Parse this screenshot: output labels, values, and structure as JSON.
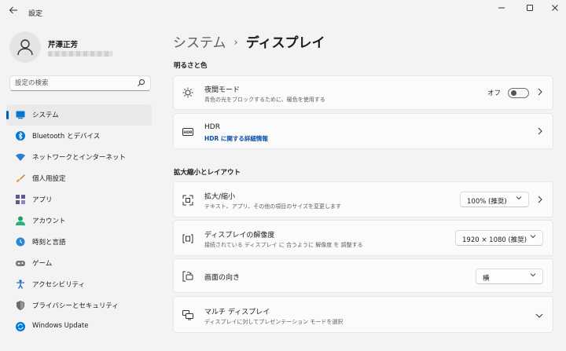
{
  "window": {
    "title": "設定",
    "back_icon": "back-arrow-icon",
    "controls": [
      "minimize-icon",
      "maximize-icon",
      "close-icon"
    ]
  },
  "user": {
    "name": "芹澤正芳"
  },
  "search": {
    "placeholder": "設定の検索"
  },
  "nav": {
    "items": [
      {
        "label": "システム",
        "icon": "system-icon",
        "selected": true
      },
      {
        "label": "Bluetooth とデバイス",
        "icon": "bluetooth-icon"
      },
      {
        "label": "ネットワークとインターネット",
        "icon": "network-icon"
      },
      {
        "label": "個人用設定",
        "icon": "brush-icon"
      },
      {
        "label": "アプリ",
        "icon": "apps-icon"
      },
      {
        "label": "アカウント",
        "icon": "account-icon"
      },
      {
        "label": "時刻と言語",
        "icon": "time-language-icon"
      },
      {
        "label": "ゲーム",
        "icon": "gaming-icon"
      },
      {
        "label": "アクセシビリティ",
        "icon": "accessibility-icon"
      },
      {
        "label": "プライバシーとセキュリティ",
        "icon": "shield-icon"
      },
      {
        "label": "Windows Update",
        "icon": "windows-update-icon"
      }
    ]
  },
  "breadcrumb": {
    "parent": "システム",
    "separator": "›",
    "current": "ディスプレイ"
  },
  "sections": {
    "brightness_color": "明るさと色",
    "scale_layout": "拡大縮小とレイアウト"
  },
  "cards": {
    "night_light": {
      "title": "夜間モード",
      "subtitle": "青色の光をブロックするために、暖色を使用する",
      "toggle_label": "オフ",
      "toggle_on": false
    },
    "hdr": {
      "title": "HDR",
      "link": "HDR に関する詳細情報"
    },
    "scale": {
      "title": "拡大/縮小",
      "subtitle": "テキスト、アプリ、その他の項目のサイズを変更します",
      "value": "100% (推奨)"
    },
    "resolution": {
      "title": "ディスプレイの解像度",
      "subtitle": "接続されている ディスプレイ に 合うように 解像度 を 調整する",
      "value": "1920 × 1080 (推奨)"
    },
    "orientation": {
      "title": "画面の向き",
      "value": "横"
    },
    "multi_display": {
      "title": "マルチ ディスプレイ",
      "subtitle": "ディスプレイに対してプレゼンテーション モードを選択"
    }
  },
  "colors": {
    "accent": "#005fb8",
    "link": "#0a4fa6",
    "background": "#f3f3f3",
    "card": "#fbfbfb"
  }
}
